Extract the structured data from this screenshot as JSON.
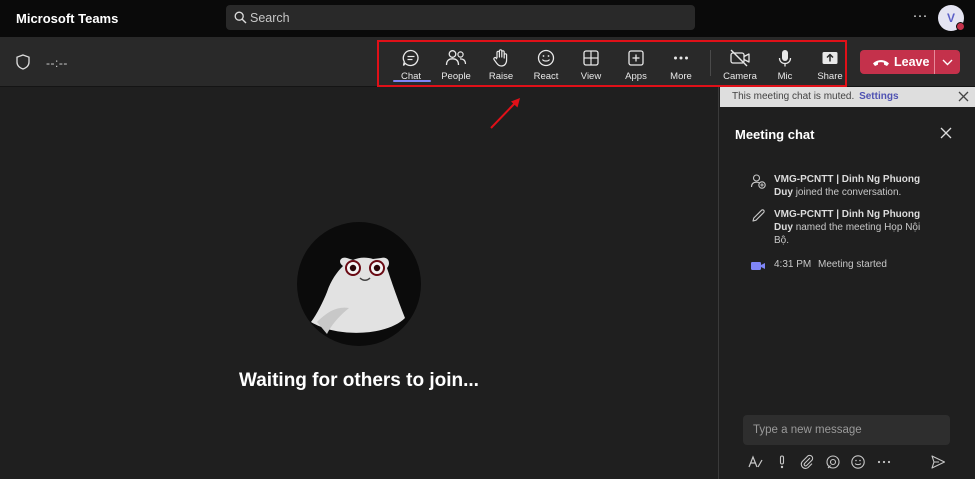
{
  "app": {
    "title": "Microsoft Teams"
  },
  "search": {
    "placeholder": "Search"
  },
  "user": {
    "initial": "V"
  },
  "meeting": {
    "timer": "--:--",
    "controls": [
      {
        "label": "Chat",
        "icon": "chat-icon",
        "active": true
      },
      {
        "label": "People",
        "icon": "people-icon"
      },
      {
        "label": "Raise",
        "icon": "raise-hand-icon"
      },
      {
        "label": "React",
        "icon": "smiley-icon"
      },
      {
        "label": "View",
        "icon": "grid-view-icon"
      },
      {
        "label": "Apps",
        "icon": "add-app-icon"
      },
      {
        "label": "More",
        "icon": "more-icon"
      },
      {
        "label": "Camera",
        "icon": "camera-off-icon"
      },
      {
        "label": "Mic",
        "icon": "mic-icon"
      },
      {
        "label": "Share",
        "icon": "share-tray-icon"
      }
    ],
    "leave_label": "Leave"
  },
  "stage": {
    "waiting_text": "Waiting for others to join..."
  },
  "chat": {
    "banner_text": "This meeting chat is muted.",
    "banner_link": "Settings",
    "title": "Meeting chat",
    "events": [
      {
        "icon": "person-join-icon",
        "actor": "VMG-PCNTT | Dinh Ng Phuong Duy",
        "text": "joined the conversation."
      },
      {
        "icon": "pencil-icon",
        "actor": "VMG-PCNTT | Dinh Ng Phuong Duy",
        "text": "named the meeting Họp Nội Bộ."
      },
      {
        "icon": "video-camera-icon",
        "time": "4:31 PM",
        "text": "Meeting started"
      }
    ],
    "composer_placeholder": "Type a new message"
  },
  "colors": {
    "accent": "#7f85f5",
    "leave": "#c4314b",
    "highlight_box": "#e01018"
  }
}
